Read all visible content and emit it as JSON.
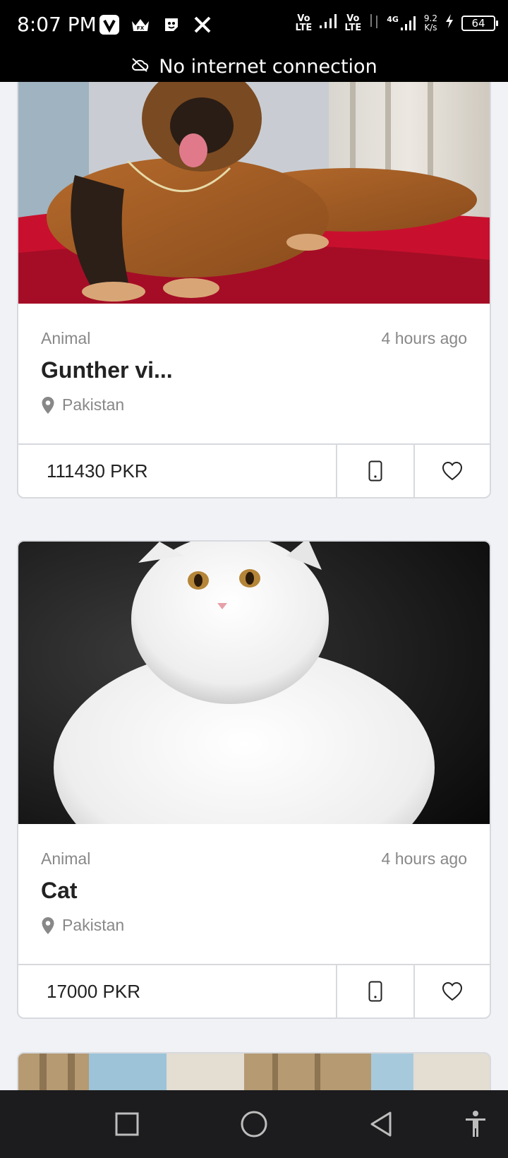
{
  "status_bar": {
    "time": "8:07 PM",
    "app_icons": [
      "v-app-icon",
      "crown-fx-icon",
      "sticker-app-icon",
      "x-app-icon"
    ],
    "sim1_label_top": "Vo",
    "sim1_label_bottom": "LTE",
    "sim2_label_top": "Vo",
    "sim2_label_bottom": "LTE",
    "network_type": "4G",
    "speed_value": "9.2",
    "speed_unit": "K/s",
    "battery": "64"
  },
  "banner": {
    "text": "No internet connection",
    "icon": "cloud-off-icon"
  },
  "listings": [
    {
      "category": "Animal",
      "time_ago": "4 hours ago",
      "title": "Gunther vi...",
      "location": "Pakistan",
      "price": "111430 PKR",
      "image": "german-shepherd-dog-photo"
    },
    {
      "category": "Animal",
      "time_ago": "4 hours ago",
      "title": "Cat",
      "location": "Pakistan",
      "price": "17000 PKR",
      "image": "white-persian-cat-photo"
    },
    {
      "image": "room-with-curtains-photo"
    }
  ],
  "nav": {
    "recent": "square-icon",
    "home": "circle-icon",
    "back": "triangle-back-icon",
    "accessibility": "accessibility-icon"
  },
  "colors": {
    "background": "#f1f2f6",
    "card_border": "#d7d9de",
    "muted_text": "#888888",
    "title_text": "#222222",
    "status_bar": "#000000",
    "nav_bar": "#1c1c1e"
  }
}
